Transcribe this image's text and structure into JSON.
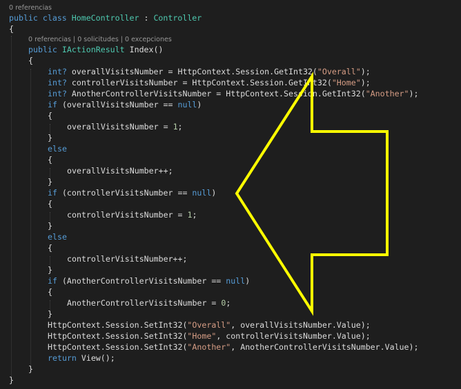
{
  "codelens": {
    "class_refs": "0 referencias",
    "method_info": "0 referencias | 0 solicitudes | 0 excepciones"
  },
  "code": {
    "l1_kw1": "public",
    "l1_kw2": "class",
    "l1_name": "HomeController",
    "l1_sep": " : ",
    "l1_base": "Controller",
    "l2": "{",
    "l3_kw": "public",
    "l3_type": "IActionResult",
    "l3_rest": " Index()",
    "l4": "{",
    "l5_type": "int?",
    "l5_a": " overallVisitsNumber = HttpContext.Session.GetInt32(",
    "l5_str": "\"Overall\"",
    "l5_end": ");",
    "l6_type": "int?",
    "l6_a": " controllerVisitsNumber = HttpContext.Session.GetInt32(",
    "l6_str": "\"Home\"",
    "l6_end": ");",
    "l7_type": "int?",
    "l7_a": " AnotherControllerVisitsNumber = HttpContext.Session.GetInt32(",
    "l7_str": "\"Another\"",
    "l7_end": ");",
    "l8_kw": "if",
    "l8_a": " (overallVisitsNumber == ",
    "l8_null": "null",
    "l8_end": ")",
    "l9": "{",
    "l10_a": "overallVisitsNumber = ",
    "l10_num": "1",
    "l10_end": ";",
    "l11": "}",
    "l12": "else",
    "l13": "{",
    "l14": "overallVisitsNumber++;",
    "l15": "}",
    "l16_kw": "if",
    "l16_a": " (controllerVisitsNumber == ",
    "l16_null": "null",
    "l16_end": ")",
    "l17": "{",
    "l18_a": "controllerVisitsNumber = ",
    "l18_num": "1",
    "l18_end": ";",
    "l19": "}",
    "l20": "else",
    "l21": "{",
    "l22": "controllerVisitsNumber++;",
    "l23": "}",
    "l24_kw": "if",
    "l24_a": " (AnotherControllerVisitsNumber == ",
    "l24_null": "null",
    "l24_end": ")",
    "l25": "{",
    "l26_a": "AnotherControllerVisitsNumber = ",
    "l26_num": "0",
    "l26_end": ";",
    "l27": "}",
    "l28_a": "HttpContext.Session.SetInt32(",
    "l28_str": "\"Overall\"",
    "l28_end": ", overallVisitsNumber.Value);",
    "l29_a": "HttpContext.Session.SetInt32(",
    "l29_str": "\"Home\"",
    "l29_end": ", controllerVisitsNumber.Value);",
    "l30_a": "HttpContext.Session.SetInt32(",
    "l30_str": "\"Another\"",
    "l30_end": ", AnotherControllerVisitsNumber.Value);",
    "l31_kw": "return",
    "l31_a": " View();",
    "l32": "}",
    "l33": "}"
  },
  "colors": {
    "background": "#1e1e1e",
    "keyword": "#569cd6",
    "type": "#4ec9b0",
    "string": "#d69d85",
    "number": "#b5cea8",
    "annotation_arrow": "#ffff00"
  }
}
